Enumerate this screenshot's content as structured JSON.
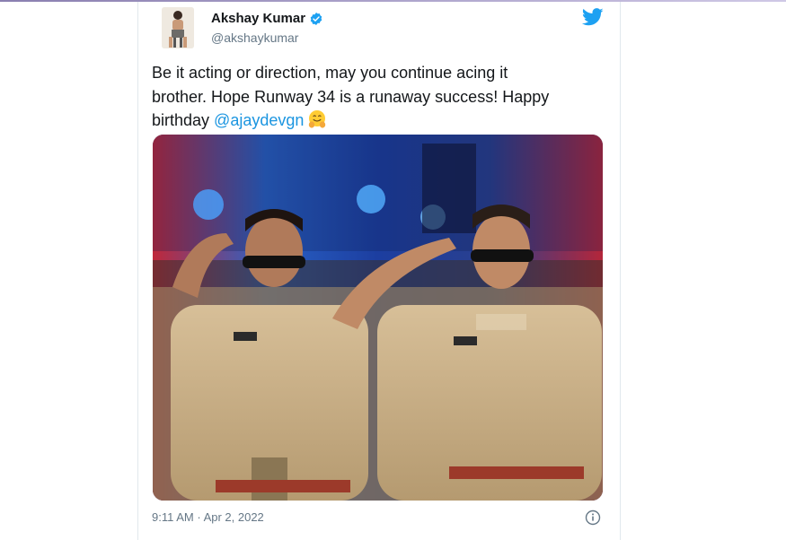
{
  "tweet": {
    "display_name": "Akshay Kumar",
    "handle": "@akshaykumar",
    "text_line1": "Be it acting or direction, may you continue acing it",
    "text_line2": "brother. Hope Runway 34 is a runaway success! Happy",
    "text_line3_prefix": "birthday ",
    "mention": "@ajaydevgn",
    "timestamp": "9:11 AM · Apr 2, 2022",
    "verified_icon": "verified-badge-icon",
    "brand_icon": "twitter-bird-icon",
    "emoji_icon": "hugging-face-emoji",
    "info_icon": "info-icon"
  },
  "colors": {
    "link": "#1b95e0",
    "twitter_blue": "#1da1f2",
    "text": "#14171a",
    "muted": "#657786"
  }
}
